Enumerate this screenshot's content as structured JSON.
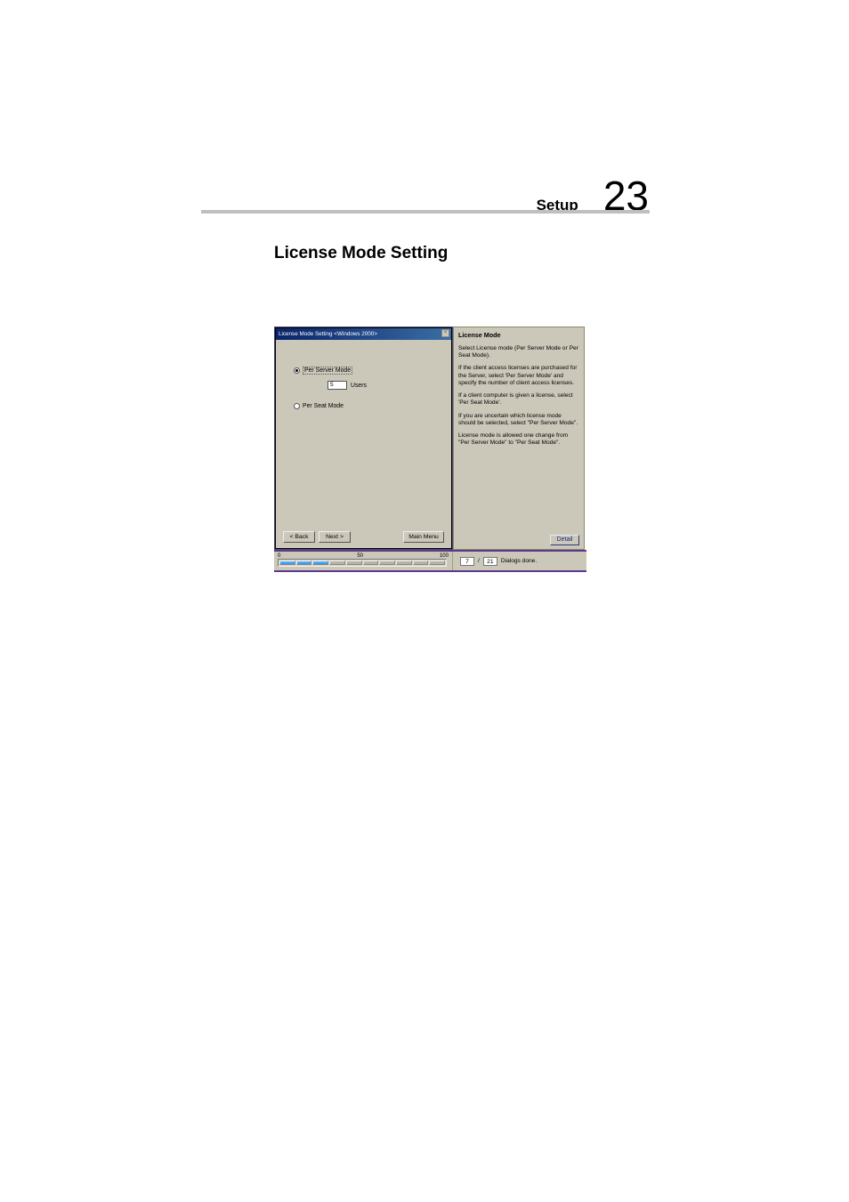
{
  "header": {
    "section_label": "Setup",
    "page_number": "23"
  },
  "section_title": "License Mode Setting",
  "dialog": {
    "title": "License Mode Setting <Windows 2000>",
    "close_glyph": "×",
    "per_server_label": "Per Server Mode",
    "users_value": "5",
    "users_label": "Users",
    "per_seat_label": "Per Seat Mode",
    "back_label": "< Back",
    "next_label": "Next >",
    "main_menu_label": "Main Menu"
  },
  "help": {
    "title": "License Mode",
    "p1": "Select License mode (Per Server Mode or Per Seat Mode).",
    "p2": "If the client access licenses are purchased for the Server, select 'Per Server Mode' and specify the number of client access licenses.",
    "p3": "If a client computer is given a license, select 'Per Seat Mode'.",
    "p4": "If you are uncertain which license mode should be selected, select \"Per Server Mode\".",
    "p5": "License mode is allowed one change from \"Per Server Mode\" to \"Per Seat Mode\".",
    "detail_label": "Detail"
  },
  "progress": {
    "label_0": "0",
    "label_50": "50",
    "label_100": "100",
    "done_current": "7",
    "slash": "/",
    "done_total": "21",
    "done_label": "Dialogs done."
  }
}
